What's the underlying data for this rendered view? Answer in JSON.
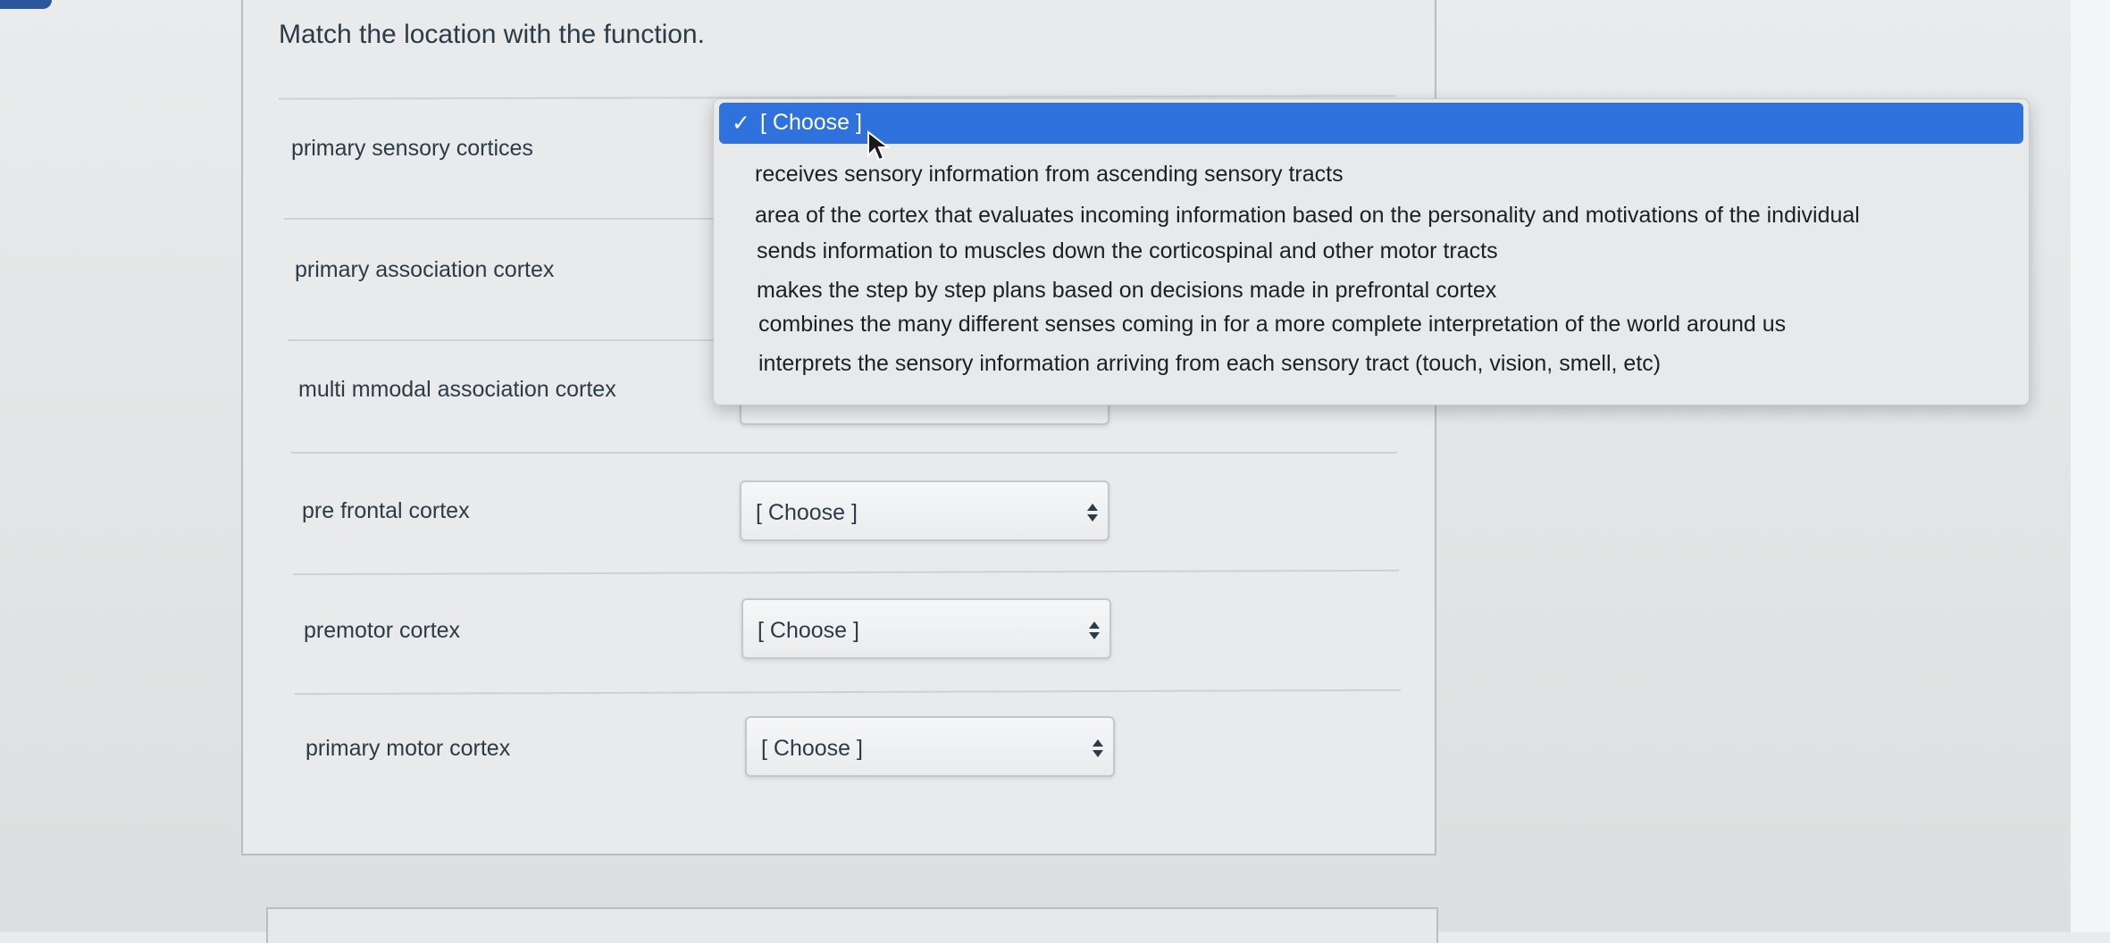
{
  "question": {
    "text": "Match the location with the function."
  },
  "rows": [
    {
      "label": "primary sensory cortices",
      "selected": "[ Choose ]"
    },
    {
      "label": "primary association cortex",
      "selected": "[ Choose ]"
    },
    {
      "label": "multi mmodal association cortex",
      "selected": "[ Choose ]"
    },
    {
      "label": "pre frontal cortex",
      "selected": "[ Choose ]"
    },
    {
      "label": "premotor cortex",
      "selected": "[ Choose ]"
    },
    {
      "label": "primary motor cortex",
      "selected": "[ Choose ]"
    }
  ],
  "dropdown": {
    "check_glyph": "✓",
    "selected_option": "[ Choose ]",
    "options": [
      "receives sensory information from ascending sensory tracts",
      "area of the cortex that evaluates incoming information based on the personality and motivations of the individual",
      "sends information to muscles down the corticospinal and other motor tracts",
      "makes the step by step plans based on decisions made in prefrontal cortex",
      "combines the many different senses coming in for a more complete interpretation of the world around us",
      "interprets the sensory information arriving from each sensory tract (touch, vision, smell, etc)"
    ]
  },
  "colors": {
    "highlight": "#2f72de",
    "text": "#2d3b45"
  },
  "icons": {
    "select_arrows": "up-down-arrows-icon",
    "check": "check-icon",
    "cursor": "mouse-pointer-icon"
  }
}
